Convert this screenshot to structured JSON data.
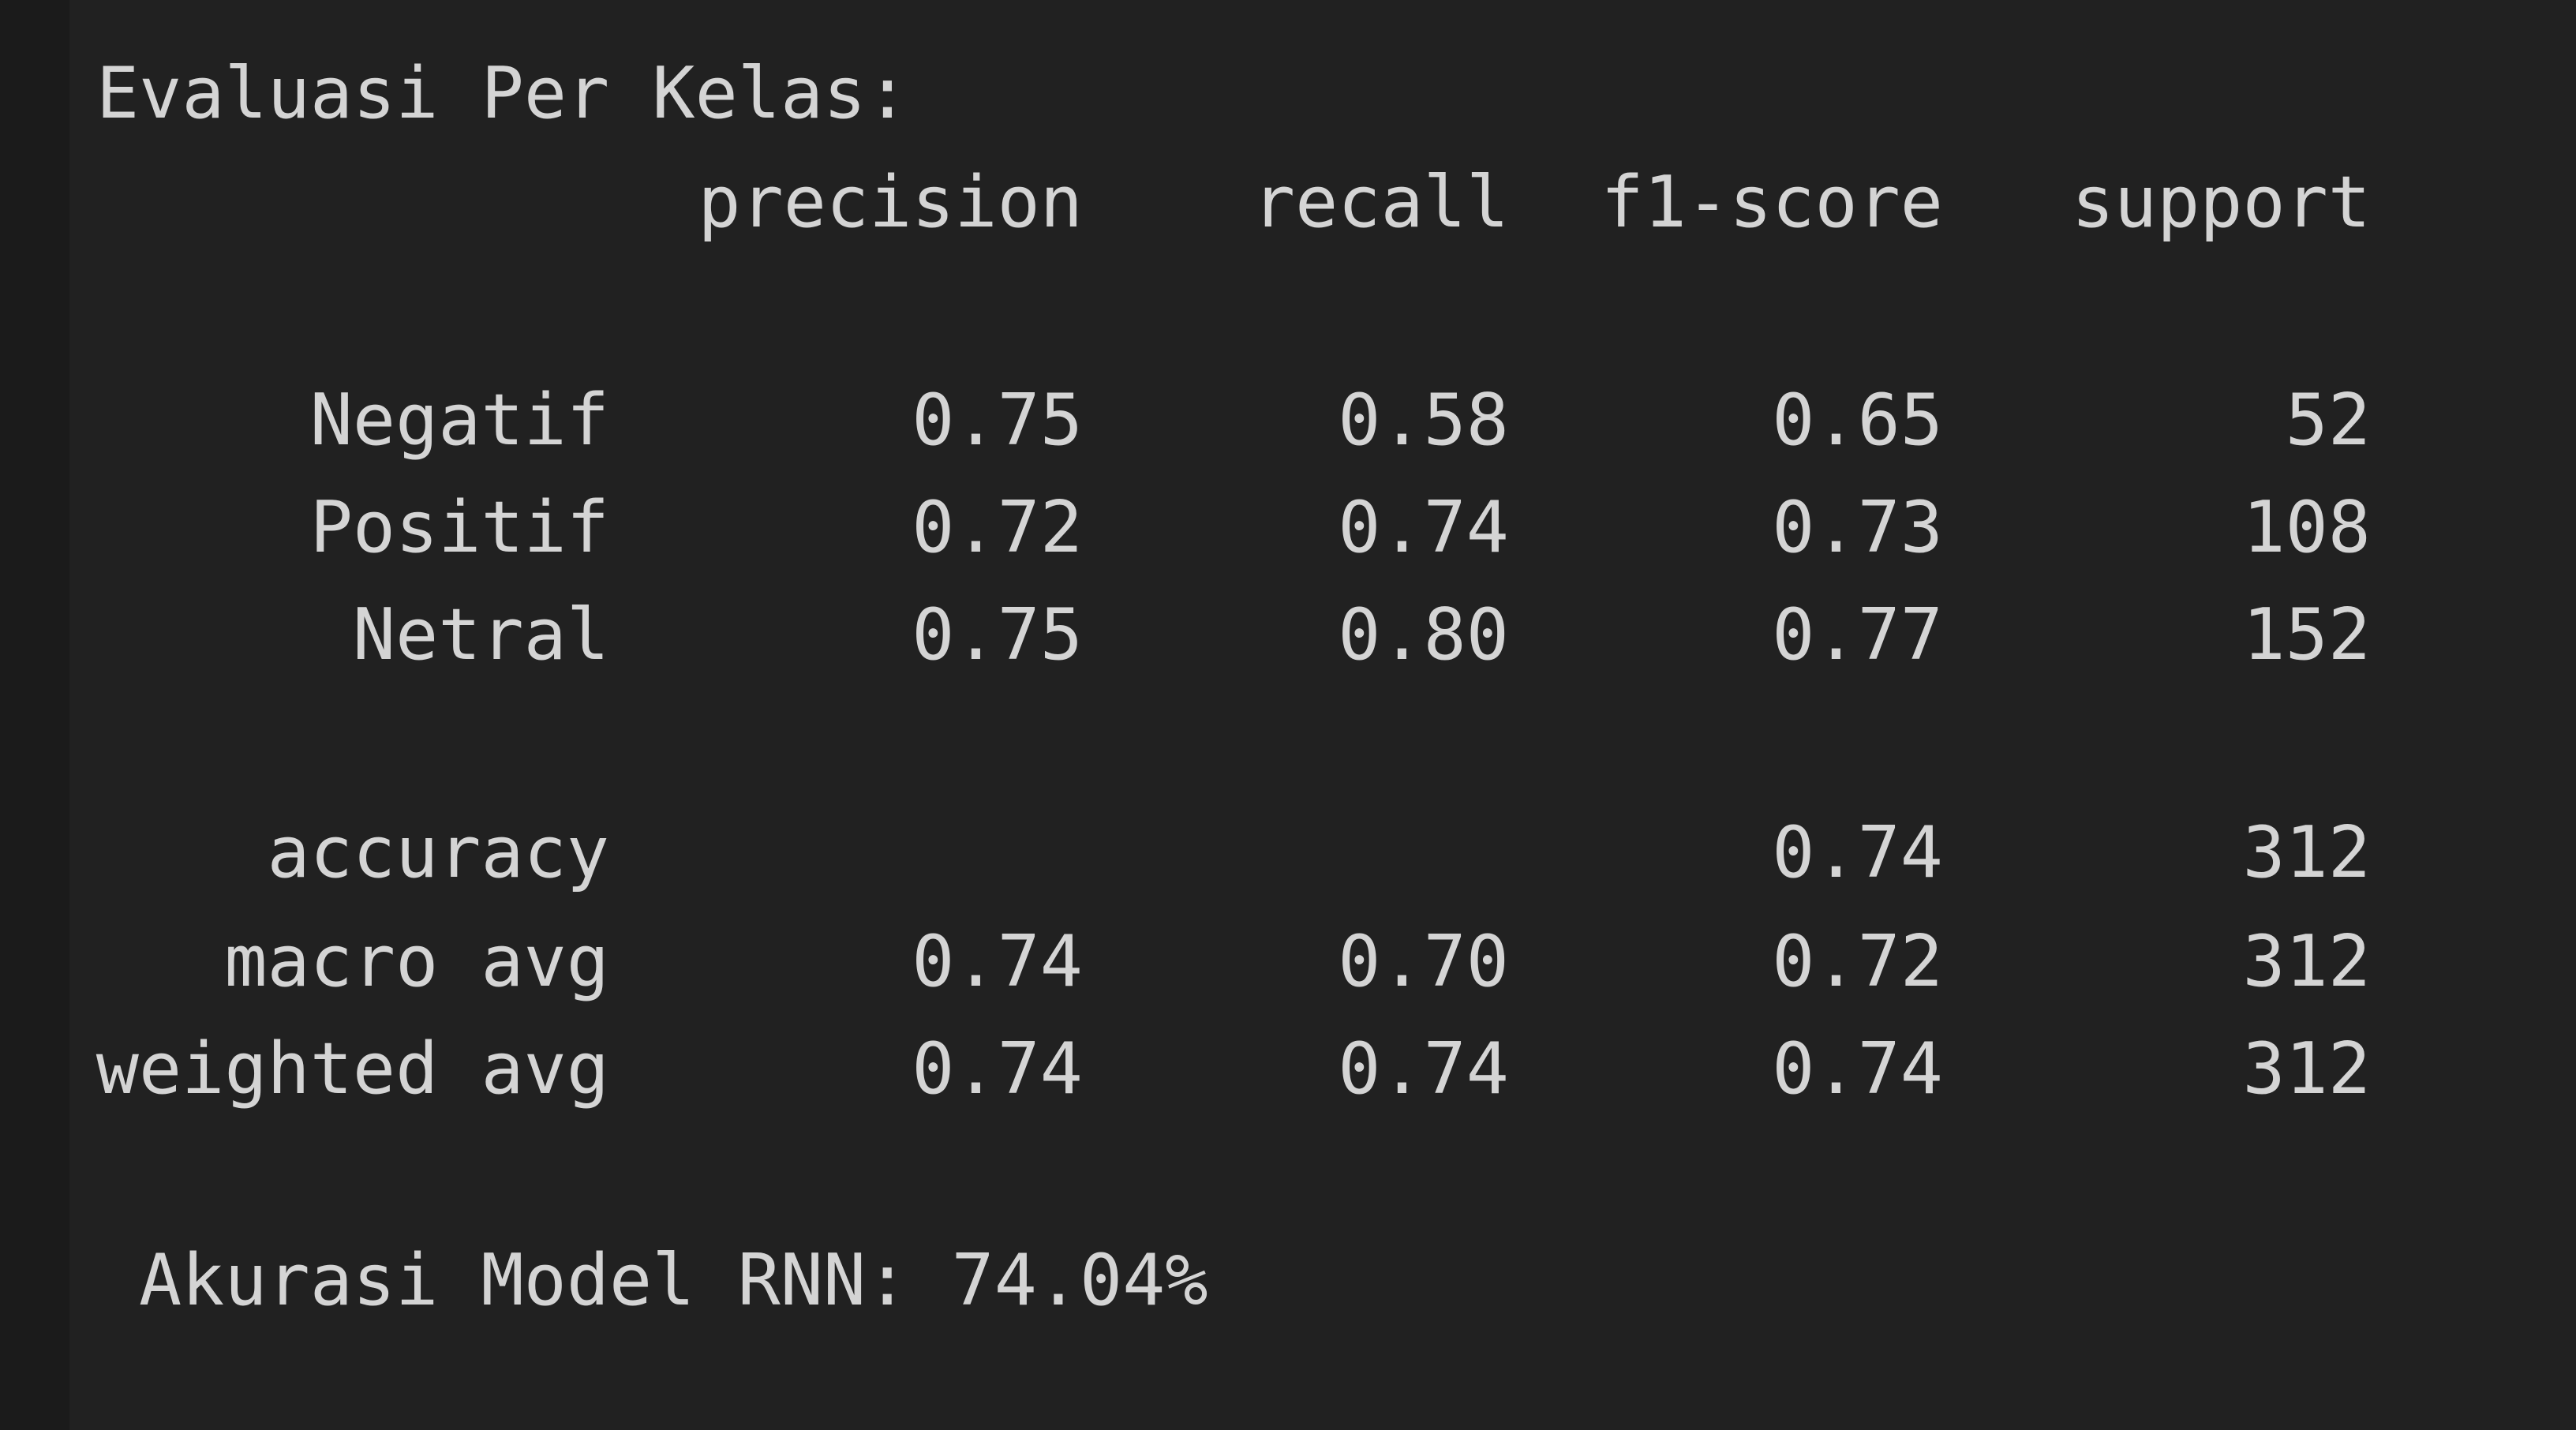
{
  "report": {
    "title": "Evaluasi Per Kelas:",
    "headers": [
      "precision",
      "recall",
      "f1-score",
      "support"
    ],
    "rows": [
      {
        "label": "Negatif",
        "precision": "0.75",
        "recall": "0.58",
        "f1": "0.65",
        "support": "52"
      },
      {
        "label": "Positif",
        "precision": "0.72",
        "recall": "0.74",
        "f1": "0.73",
        "support": "108"
      },
      {
        "label": "Netral",
        "precision": "0.75",
        "recall": "0.80",
        "f1": "0.77",
        "support": "152"
      }
    ],
    "summary": [
      {
        "label": "accuracy",
        "precision": "",
        "recall": "",
        "f1": "0.74",
        "support": "312"
      },
      {
        "label": "macro avg",
        "precision": "0.74",
        "recall": "0.70",
        "f1": "0.72",
        "support": "312"
      },
      {
        "label": "weighted avg",
        "precision": "0.74",
        "recall": "0.74",
        "f1": "0.74",
        "support": "312"
      }
    ]
  },
  "accuracy_line": "Akurasi Model RNN: 74.04%"
}
